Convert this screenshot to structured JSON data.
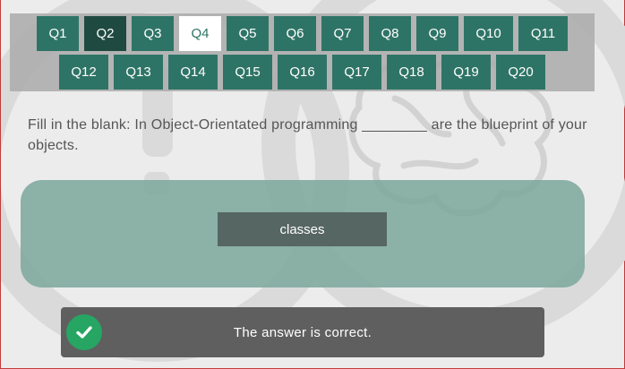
{
  "question_nav": {
    "row1": [
      {
        "label": "Q1",
        "state": "default"
      },
      {
        "label": "Q2",
        "state": "answered"
      },
      {
        "label": "Q3",
        "state": "default"
      },
      {
        "label": "Q4",
        "state": "current"
      },
      {
        "label": "Q5",
        "state": "default"
      },
      {
        "label": "Q6",
        "state": "default"
      },
      {
        "label": "Q7",
        "state": "default"
      },
      {
        "label": "Q8",
        "state": "default"
      },
      {
        "label": "Q9",
        "state": "default"
      },
      {
        "label": "Q10",
        "state": "default"
      },
      {
        "label": "Q11",
        "state": "default"
      }
    ],
    "row2": [
      {
        "label": "Q12",
        "state": "default"
      },
      {
        "label": "Q13",
        "state": "default"
      },
      {
        "label": "Q14",
        "state": "default"
      },
      {
        "label": "Q15",
        "state": "default"
      },
      {
        "label": "Q16",
        "state": "default"
      },
      {
        "label": "Q17",
        "state": "default"
      },
      {
        "label": "Q18",
        "state": "default"
      },
      {
        "label": "Q19",
        "state": "default"
      },
      {
        "label": "Q20",
        "state": "default"
      }
    ]
  },
  "question": {
    "text": "Fill in the blank: In Object-Orientated programming ________ are the blueprint of your objects."
  },
  "answer": {
    "value": "classes"
  },
  "feedback": {
    "message": "The answer is correct.",
    "icon": "check-circle-icon"
  },
  "colors": {
    "nav_button": "#2e7466",
    "nav_answered": "#1f4a41",
    "nav_current": "#ffffff",
    "answer_panel": "#7ba79b",
    "answer_chip": "#566663",
    "feedback_bg": "#5f5f5f",
    "success": "#27a563"
  }
}
